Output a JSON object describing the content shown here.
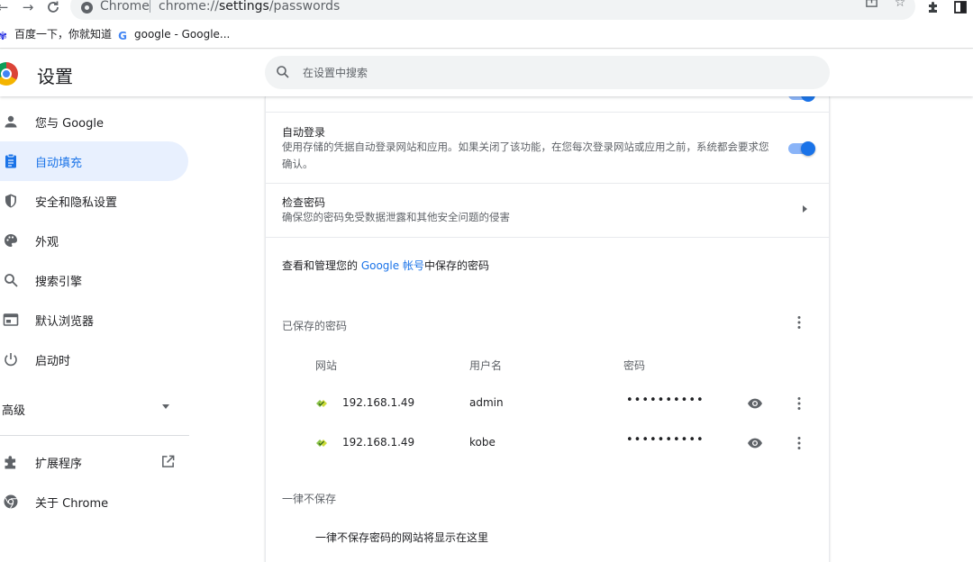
{
  "browser": {
    "tab_name": "Chrome",
    "url_prefix": "chrome://",
    "url_host": "settings",
    "url_path": "/passwords",
    "icons": {
      "back": "arrow-left-icon",
      "forward": "arrow-right-icon",
      "reload": "reload-icon",
      "share": "share-icon",
      "bookmark": "star-icon",
      "extensions": "puzzle-icon",
      "sidepanel": "side-panel-icon"
    }
  },
  "bookmarks": [
    {
      "label": "百度一下，你就知道",
      "icon": "baidu-paw-icon"
    },
    {
      "label": "google - Google...",
      "icon": "google-g-icon"
    }
  ],
  "header": {
    "title": "设置",
    "search_placeholder": "在设置中搜索"
  },
  "sidebar": {
    "items": [
      {
        "label": "您与 Google",
        "icon": "person-icon",
        "active": false
      },
      {
        "label": "自动填充",
        "icon": "clipboard-icon",
        "active": true
      },
      {
        "label": "安全和隐私设置",
        "icon": "shield-icon",
        "active": false
      },
      {
        "label": "外观",
        "icon": "palette-icon",
        "active": false
      },
      {
        "label": "搜索引擎",
        "icon": "search-icon",
        "active": false
      },
      {
        "label": "默认浏览器",
        "icon": "browser-window-icon",
        "active": false
      },
      {
        "label": "启动时",
        "icon": "power-icon",
        "active": false
      }
    ],
    "advanced_label": "高级",
    "bottom_items": [
      {
        "label": "扩展程序",
        "icon": "puzzle-icon"
      },
      {
        "label": "关于 Chrome",
        "icon": "chrome-icon"
      }
    ]
  },
  "main": {
    "auto_signin": {
      "title": "自动登录",
      "description": "使用存储的凭据自动登录网站和应用。如果关闭了该功能，在您每次登录网站或应用之前，系统都会要求您确认。",
      "enabled": true
    },
    "check_passwords": {
      "title": "检查密码",
      "description": "确保您的密码免受数据泄露和其他安全问题的侵害"
    },
    "manage": {
      "prefix": "查看和管理您的 ",
      "link": "Google 帐号",
      "suffix": "中保存的密码"
    },
    "saved_passwords": {
      "label": "已保存的密码",
      "columns": [
        "网站",
        "用户名",
        "密码"
      ],
      "rows": [
        {
          "site": "192.168.1.49",
          "username": "admin",
          "password_mask": "••••••••••"
        },
        {
          "site": "192.168.1.49",
          "username": "kobe",
          "password_mask": "••••••••••"
        }
      ]
    },
    "never_saved": {
      "label": "一律不保存",
      "empty_text": "一律不保存密码的网站将显示在这里"
    }
  }
}
